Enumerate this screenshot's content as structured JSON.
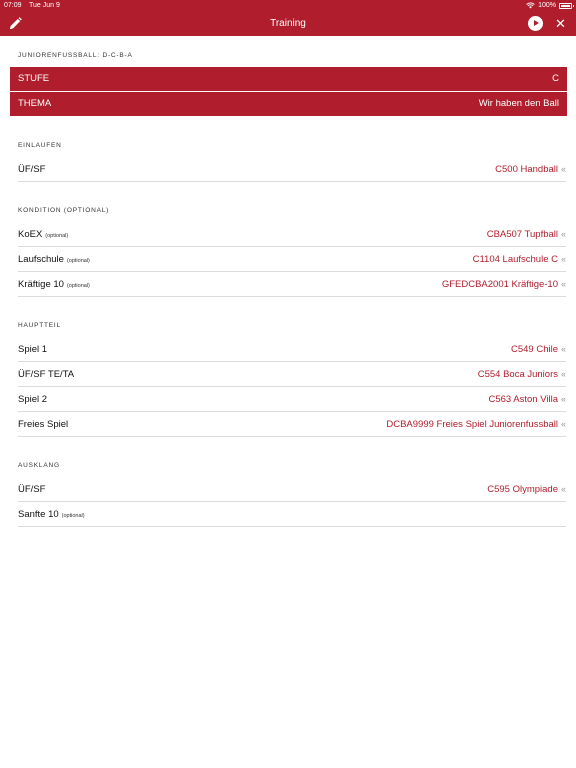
{
  "status_bar": {
    "time": "07:09",
    "date": "Tue Jun 9",
    "battery": "100%"
  },
  "navbar": {
    "title": "Training"
  },
  "header_section": {
    "title": "JUNIORENFUSSBALL: D-C-B-A",
    "stufe_label": "STUFE",
    "stufe_value": "C",
    "thema_label": "THEMA",
    "thema_value": "Wir haben den Ball"
  },
  "optional_tag": "(optional)",
  "chevron": "«",
  "sections": {
    "einlaufen": {
      "title": "EINLAUFEN",
      "rows": [
        {
          "label": "ÜF/SF",
          "value": "C500 Handball"
        }
      ]
    },
    "kondition": {
      "title": "KONDITION (OPTIONAL)",
      "rows": [
        {
          "label": "KoEX",
          "value": "CBA507 Tupfball"
        },
        {
          "label": "Laufschule",
          "value": "C1104 Laufschule C"
        },
        {
          "label": "Kräftige 10",
          "value": "GFEDCBA2001 Kräftige-10"
        }
      ]
    },
    "hauptteil": {
      "title": "HAUPTTEIL",
      "rows": [
        {
          "label": "Spiel 1",
          "value": "C549 Chile"
        },
        {
          "label": "ÜF/SF TE/TA",
          "value": "C554 Boca Juniors"
        },
        {
          "label": "Spiel 2",
          "value": "C563 Aston Villa"
        },
        {
          "label": "Freies Spiel",
          "value": "DCBA9999 Freies Spiel Juniorenfussball"
        }
      ]
    },
    "ausklang": {
      "title": "AUSKLANG",
      "rows": [
        {
          "label": "ÜF/SF",
          "value": "C595 Olympiade"
        },
        {
          "label": "Sanfte 10",
          "value": ""
        }
      ]
    }
  },
  "colors": {
    "accent": "#b01e2d",
    "chevron": "#999999",
    "separator": "#dcdcdc"
  },
  "icons": {
    "edit": "pencil-icon",
    "play": "play-icon",
    "close": "close-icon",
    "wifi": "wifi-icon",
    "battery": "battery-icon",
    "chevron": "double-chevron-left-icon"
  }
}
